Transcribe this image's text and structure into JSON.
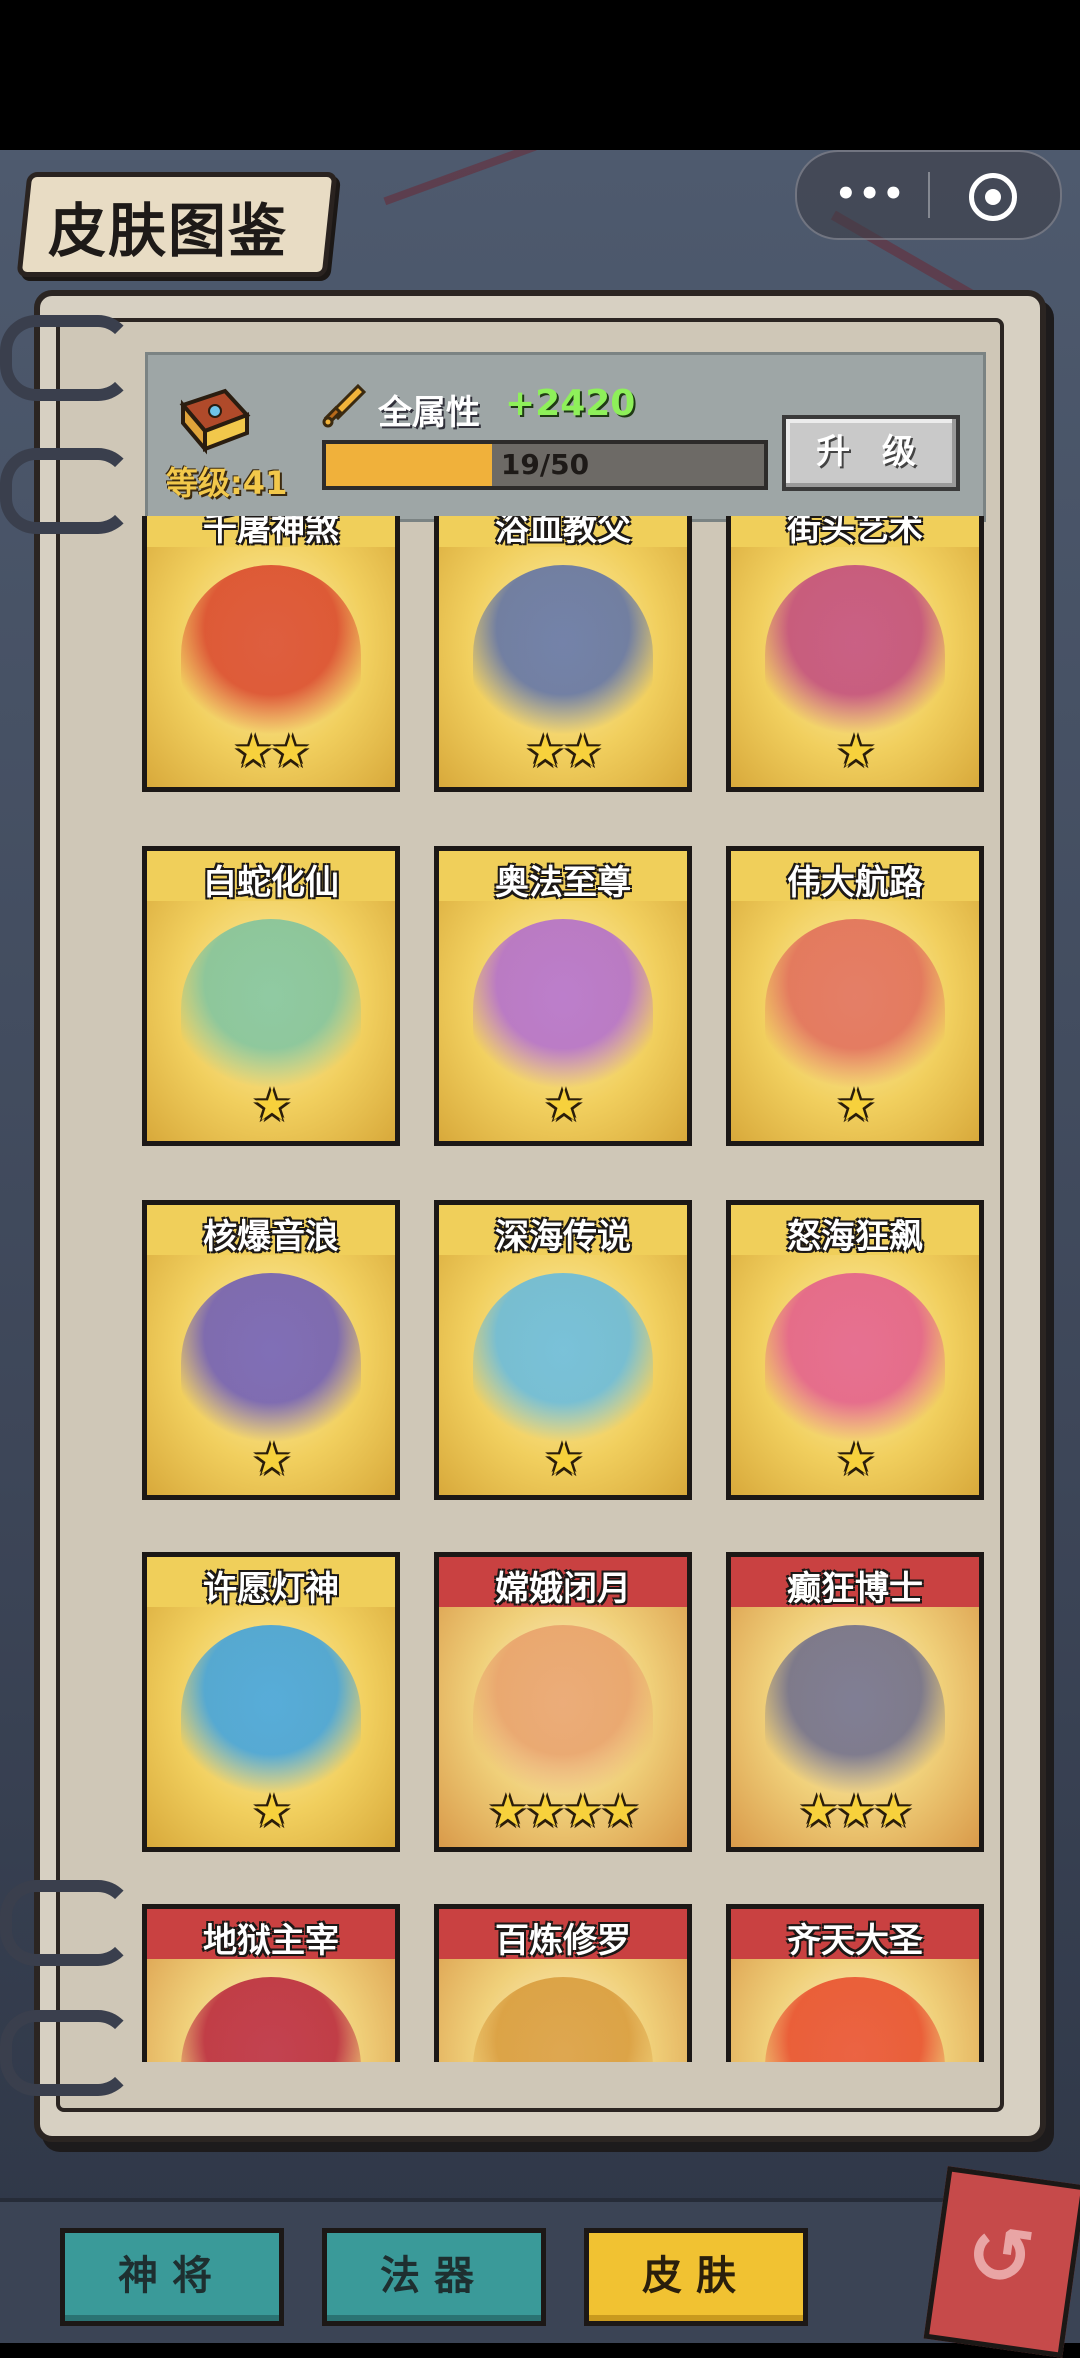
{
  "header": {
    "title": "皮肤图鉴"
  },
  "capsule": {
    "more_icon": "more-dots-icon",
    "close_icon": "target-close-icon"
  },
  "stats": {
    "level_label": "等级:41",
    "attr_label": "全属性",
    "attr_value": "+2420",
    "progress_text": "19/50",
    "progress_fraction": 0.38,
    "upgrade_label": "升 级"
  },
  "skins": [
    {
      "name": "千屠神煞",
      "stars": "★★",
      "frame": "yellow",
      "color": "#d9442b"
    },
    {
      "name": "浴血教父",
      "stars": "★★",
      "frame": "yellow",
      "color": "#5b6fa8"
    },
    {
      "name": "街头艺术",
      "stars": "★",
      "frame": "yellow",
      "color": "#c0477d"
    },
    {
      "name": "白蛇化仙",
      "stars": "★",
      "frame": "yellow",
      "color": "#7cc3a0"
    },
    {
      "name": "奥法至尊",
      "stars": "★",
      "frame": "yellow",
      "color": "#b06ad0"
    },
    {
      "name": "伟大航路",
      "stars": "★",
      "frame": "yellow",
      "color": "#e06a5a"
    },
    {
      "name": "核爆音浪",
      "stars": "★",
      "frame": "yellow",
      "color": "#6a58b8"
    },
    {
      "name": "深海传说",
      "stars": "★",
      "frame": "yellow",
      "color": "#62b9e0"
    },
    {
      "name": "怒海狂飙",
      "stars": "★",
      "frame": "yellow",
      "color": "#e25a8c"
    },
    {
      "name": "许愿灯神",
      "stars": "★",
      "frame": "yellow",
      "color": "#3aa0e0"
    },
    {
      "name": "嫦娥闭月",
      "stars": "★★★★",
      "frame": "red",
      "color": "#e8a06a"
    },
    {
      "name": "癫狂博士",
      "stars": "★★★",
      "frame": "red",
      "color": "#6a6a8a"
    },
    {
      "name": "地狱主宰",
      "stars": "",
      "frame": "red",
      "color": "#b8233a"
    },
    {
      "name": "百炼修罗",
      "stars": "",
      "frame": "red",
      "color": "#d89a3a"
    },
    {
      "name": "齐天大圣",
      "stars": "",
      "frame": "red",
      "color": "#e84a2a"
    }
  ],
  "tabs": [
    {
      "label": "神将",
      "style": "teal"
    },
    {
      "label": "法器",
      "style": "teal"
    },
    {
      "label": "皮肤",
      "style": "yellow"
    }
  ],
  "back_icon": "return-arrow-icon"
}
